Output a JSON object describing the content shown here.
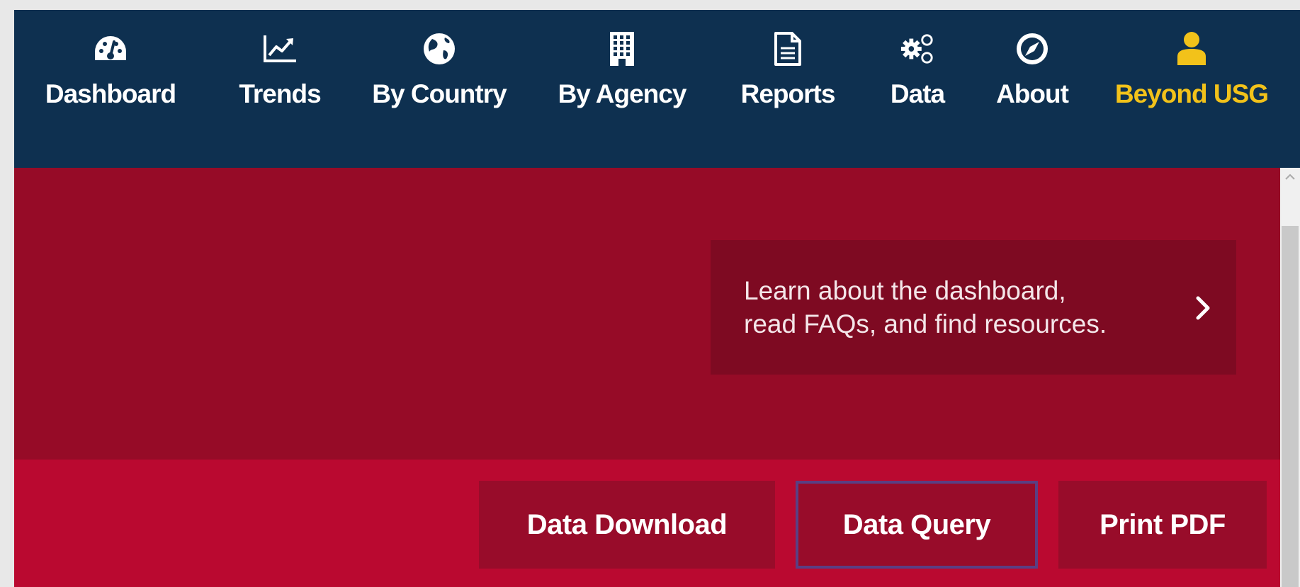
{
  "nav": {
    "items": [
      {
        "label": "Dashboard",
        "icon": "dashboard-gauge-icon"
      },
      {
        "label": "Trends",
        "icon": "trend-line-chart-icon"
      },
      {
        "label": "By Country",
        "icon": "globe-icon"
      },
      {
        "label": "By Agency",
        "icon": "building-icon"
      },
      {
        "label": "Reports",
        "icon": "document-icon"
      },
      {
        "label": "Data",
        "icon": "gears-icon"
      },
      {
        "label": "About",
        "icon": "compass-icon"
      },
      {
        "label": "Beyond USG",
        "icon": "user-icon"
      }
    ],
    "highlight_color": "#f2c21a"
  },
  "hero": {
    "learn_text": "Learn about the dashboard,\nread FAQs, and find resources.",
    "chevron_icon": "chevron-right-icon"
  },
  "actions": {
    "data_download": "Data Download",
    "data_query": "Data Query",
    "print_pdf": "Print PDF"
  },
  "colors": {
    "nav_bg": "#0e3050",
    "hero_bg": "#960b27",
    "action_bar_bg": "#ba0930",
    "button_bg": "#980c2a"
  }
}
